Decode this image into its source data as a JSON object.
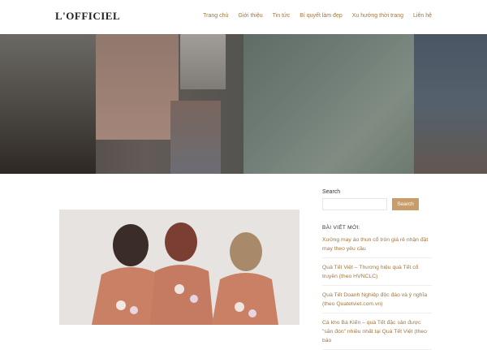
{
  "site": {
    "logo_text": "L'OFFICIEL"
  },
  "nav": {
    "items": [
      {
        "label": "Trang chủ"
      },
      {
        "label": "Giới thiệu"
      },
      {
        "label": "Tin tức"
      },
      {
        "label": "Bí quyết làm đẹp"
      },
      {
        "label": "Xu hướng thời trang"
      },
      {
        "label": "Liên hệ"
      }
    ]
  },
  "sidebar": {
    "search_label": "Search",
    "search_button": "Search",
    "recent_title": "BÀI VIẾT MỚI:",
    "posts": [
      {
        "title": "Xưởng may áo thun cổ tròn giá rẻ nhận đặt may theo yêu cầu"
      },
      {
        "title": "Quà Tết Việt – Thương hiệu quà Tết cổ truyền (theo HVNCLC)"
      },
      {
        "title": "Quà Tết Doanh Nghiệp độc đáo và ý nghĩa (theo Quatetviet.com.vn)"
      },
      {
        "title": "Cá kho Bá Kiến – quà Tết đặc sản được \"săn đón\" nhiều nhất tại Quà Tết Việt (theo báo"
      }
    ]
  },
  "colors": {
    "accent": "#c89d6a",
    "link": "#a2763f"
  }
}
